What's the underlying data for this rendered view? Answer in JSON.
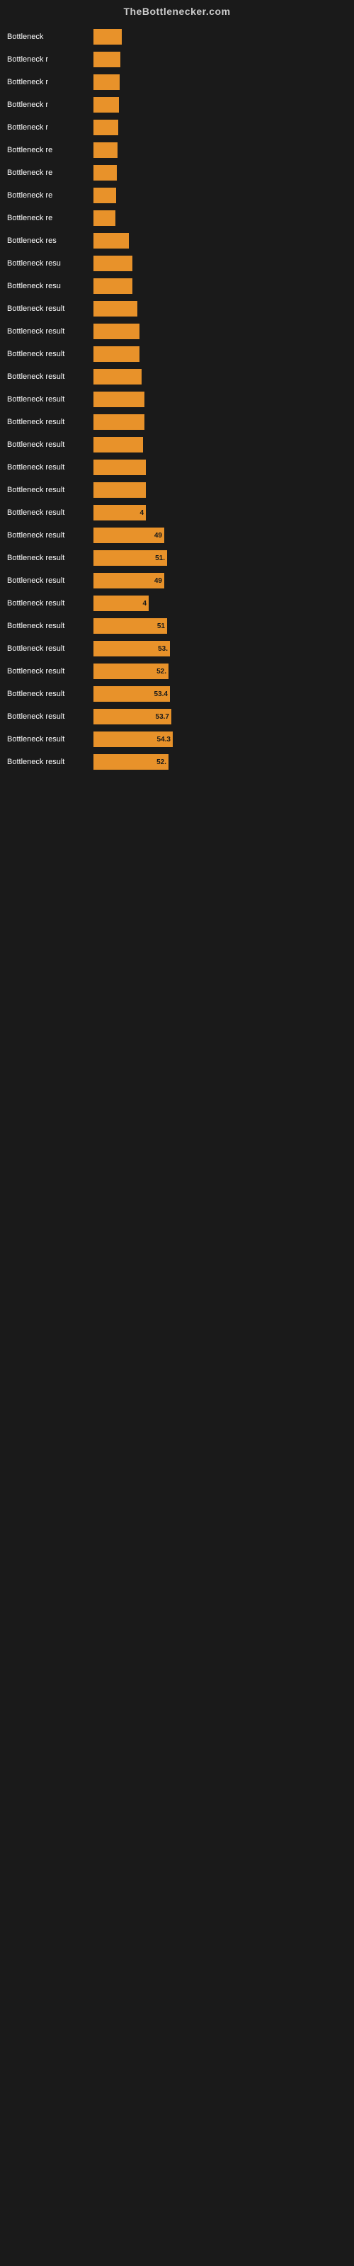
{
  "header": {
    "title": "TheBottlenecker.com"
  },
  "bars": [
    {
      "label": "Bottleneck",
      "width": 40,
      "value": "",
      "valueOutside": ""
    },
    {
      "label": "Bottleneck r",
      "width": 38,
      "value": "",
      "valueOutside": ""
    },
    {
      "label": "Bottleneck r",
      "width": 37,
      "value": "",
      "valueOutside": ""
    },
    {
      "label": "Bottleneck r",
      "width": 36,
      "value": "",
      "valueOutside": ""
    },
    {
      "label": "Bottleneck r",
      "width": 35,
      "value": "",
      "valueOutside": ""
    },
    {
      "label": "Bottleneck re",
      "width": 34,
      "value": "",
      "valueOutside": ""
    },
    {
      "label": "Bottleneck re",
      "width": 33,
      "value": "",
      "valueOutside": ""
    },
    {
      "label": "Bottleneck re",
      "width": 32,
      "value": "",
      "valueOutside": ""
    },
    {
      "label": "Bottleneck re",
      "width": 31,
      "value": "",
      "valueOutside": ""
    },
    {
      "label": "Bottleneck res",
      "width": 50,
      "value": "",
      "valueOutside": ""
    },
    {
      "label": "Bottleneck resu",
      "width": 55,
      "value": "",
      "valueOutside": ""
    },
    {
      "label": "Bottleneck resu",
      "width": 55,
      "value": "",
      "valueOutside": ""
    },
    {
      "label": "Bottleneck result",
      "width": 62,
      "value": "",
      "valueOutside": ""
    },
    {
      "label": "Bottleneck result",
      "width": 65,
      "value": "",
      "valueOutside": ""
    },
    {
      "label": "Bottleneck result",
      "width": 65,
      "value": "",
      "valueOutside": ""
    },
    {
      "label": "Bottleneck result",
      "width": 68,
      "value": "",
      "valueOutside": ""
    },
    {
      "label": "Bottleneck result",
      "width": 72,
      "value": "",
      "valueOutside": ""
    },
    {
      "label": "Bottleneck result",
      "width": 72,
      "value": "",
      "valueOutside": ""
    },
    {
      "label": "Bottleneck result",
      "width": 70,
      "value": "",
      "valueOutside": ""
    },
    {
      "label": "Bottleneck result",
      "width": 74,
      "value": "",
      "valueOutside": ""
    },
    {
      "label": "Bottleneck result",
      "width": 74,
      "value": "",
      "valueOutside": ""
    },
    {
      "label": "Bottleneck result",
      "width": 74,
      "value": "4",
      "valueOutside": ""
    },
    {
      "label": "Bottleneck result",
      "width": 100,
      "value": "49",
      "valueOutside": ""
    },
    {
      "label": "Bottleneck result",
      "width": 104,
      "value": "51.",
      "valueOutside": ""
    },
    {
      "label": "Bottleneck result",
      "width": 100,
      "value": "49",
      "valueOutside": ""
    },
    {
      "label": "Bottleneck result",
      "width": 78,
      "value": "4",
      "valueOutside": ""
    },
    {
      "label": "Bottleneck result",
      "width": 104,
      "value": "51",
      "valueOutside": ""
    },
    {
      "label": "Bottleneck result",
      "width": 108,
      "value": "53.",
      "valueOutside": ""
    },
    {
      "label": "Bottleneck result",
      "width": 106,
      "value": "52.",
      "valueOutside": ""
    },
    {
      "label": "Bottleneck result",
      "width": 108,
      "value": "53.4",
      "valueOutside": ""
    },
    {
      "label": "Bottleneck result",
      "width": 110,
      "value": "53.7",
      "valueOutside": ""
    },
    {
      "label": "Bottleneck result",
      "width": 112,
      "value": "54.3",
      "valueOutside": ""
    },
    {
      "label": "Bottleneck result",
      "width": 106,
      "value": "52.",
      "valueOutside": ""
    }
  ]
}
